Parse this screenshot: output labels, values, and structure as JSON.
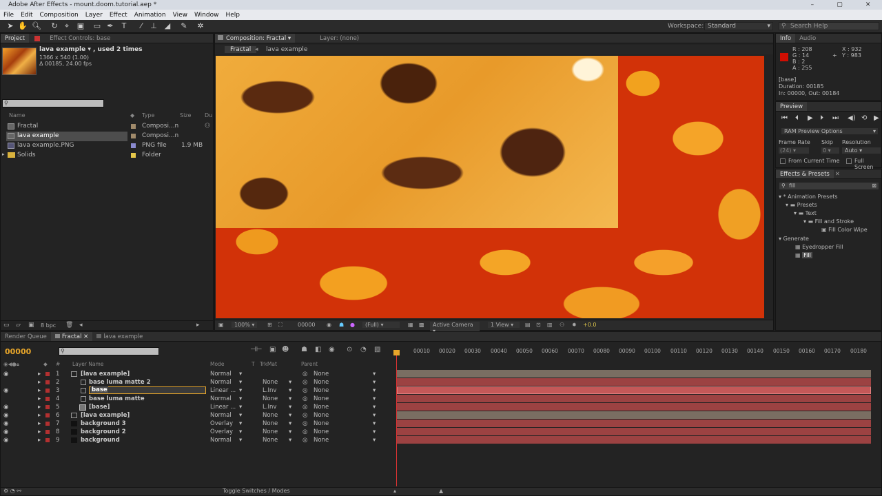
{
  "window": {
    "title": "Adobe After Effects - mount.doom.tutorial.aep *"
  },
  "menu": [
    "File",
    "Edit",
    "Composition",
    "Layer",
    "Effect",
    "Animation",
    "View",
    "Window",
    "Help"
  ],
  "toolbar": {
    "workspace_label": "Workspace:",
    "workspace_value": "Standard",
    "search_placeholder": "Search Help"
  },
  "project": {
    "tabs": [
      "Project",
      "Effect Controls: base"
    ],
    "item_name": "lava example ▾ , used 2 times",
    "item_size": "1366 x 540 (1.00)",
    "item_duration": "Δ 00185, 24.00 fps",
    "columns": {
      "name": "Name",
      "type": "Type",
      "size": "Size",
      "dur": "Du"
    },
    "items": [
      {
        "name": "Fractal",
        "type": "Composi...n",
        "size": "",
        "color": "#a08a6a"
      },
      {
        "name": "lava example",
        "type": "Composi...n",
        "size": "",
        "color": "#a08a6a"
      },
      {
        "name": "lava example.PNG",
        "type": "PNG file",
        "size": "1.9 MB",
        "color": "#8a8ad0"
      },
      {
        "name": "Solids",
        "type": "Folder",
        "size": "",
        "color": "#e6c84a"
      }
    ],
    "bpc": "8 bpc"
  },
  "comp": {
    "tab": "Composition: Fractal",
    "layer_tab": "Layer: (none)",
    "breadcrumbs": [
      "Fractal",
      "lava example"
    ],
    "zoom": "100%",
    "timecode": "00000",
    "resolution": "(Full)",
    "camera": "Active Camera",
    "view": "1 View",
    "exposure": "+0.0"
  },
  "info": {
    "tabs": [
      "Info",
      "Audio"
    ],
    "r": "R : 208",
    "g": "G : 14",
    "b": "B : 2",
    "a": "A : 255",
    "x": "X : 932",
    "y": "Y : 983",
    "layer": "[base]",
    "duration": "Duration: 00185",
    "inout": "In: 00000, Out: 00184",
    "swatch": "#d00e02"
  },
  "preview": {
    "title": "Preview",
    "ram": "RAM Preview Options",
    "frame_rate_label": "Frame Rate",
    "skip_label": "Skip",
    "resolution_label": "Resolution",
    "frame_rate": "(24)",
    "skip": "0",
    "resolution": "Auto",
    "from_current": "From Current Time",
    "full_screen": "Full Screen"
  },
  "effects": {
    "title": "Effects & Presets",
    "search": "fill",
    "tree": [
      "* Animation Presets",
      "Presets",
      "Text",
      "Fill and Stroke",
      "Fill Color Wipe",
      "Generate",
      "Eyedropper Fill",
      "Fill"
    ]
  },
  "timeline": {
    "tabs": [
      "Render Queue",
      "Fractal",
      "lava example"
    ],
    "timecode": "00000",
    "headers": {
      "name": "Layer Name",
      "mode": "Mode",
      "t": "T",
      "trkmat": "TrkMat",
      "parent": "Parent"
    },
    "ruler": [
      "00010",
      "00020",
      "00030",
      "00040",
      "00050",
      "00060",
      "00070",
      "00080",
      "00090",
      "00100",
      "00110",
      "00120",
      "00130",
      "00140",
      "00150",
      "00160",
      "00170",
      "00180"
    ],
    "layers": [
      {
        "num": "1",
        "name": "[lava example]",
        "mode": "Normal",
        "trkmat": "",
        "parent": "None",
        "color": "#b33030",
        "type": "comp"
      },
      {
        "num": "2",
        "name": "base luma matte 2",
        "mode": "Normal",
        "trkmat": "None",
        "parent": "None",
        "color": "#b33030",
        "type": "solid"
      },
      {
        "num": "3",
        "name": "base",
        "mode": "Linear ...",
        "trkmat": "L.Inv",
        "parent": "None",
        "color": "#b33030",
        "type": "solid"
      },
      {
        "num": "4",
        "name": "base luma matte",
        "mode": "Normal",
        "trkmat": "None",
        "parent": "None",
        "color": "#b33030",
        "type": "solid"
      },
      {
        "num": "5",
        "name": "[base]",
        "mode": "Linear ...",
        "trkmat": "L.Inv",
        "parent": "None",
        "color": "#b33030",
        "type": "comp"
      },
      {
        "num": "6",
        "name": "[lava example]",
        "mode": "Normal",
        "trkmat": "None",
        "parent": "None",
        "color": "#b33030",
        "type": "comp"
      },
      {
        "num": "7",
        "name": "background 3",
        "mode": "Overlay",
        "trkmat": "None",
        "parent": "None",
        "color": "#b33030",
        "type": "solid"
      },
      {
        "num": "8",
        "name": "background 2",
        "mode": "Overlay",
        "trkmat": "None",
        "parent": "None",
        "color": "#b33030",
        "type": "solid"
      },
      {
        "num": "9",
        "name": "background",
        "mode": "Normal",
        "trkmat": "None",
        "parent": "None",
        "color": "#b33030",
        "type": "solid"
      }
    ],
    "toggle": "Toggle Switches / Modes"
  }
}
